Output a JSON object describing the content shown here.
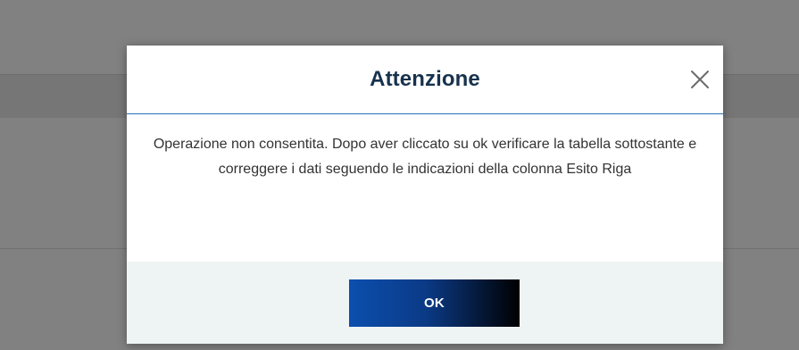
{
  "dialog": {
    "title": "Attenzione",
    "message": "Operazione non consentita. Dopo aver cliccato su ok verificare la tabella sottostante e correggere i dati seguendo le indicazioni della colonna Esito Riga",
    "ok_label": "OK",
    "close_icon": "close-icon"
  },
  "colors": {
    "title": "#17324d",
    "header_rule": "#1f73b7",
    "footer_bg": "#eef3f4",
    "button_gradient_start": "#0b4fae",
    "button_gradient_end": "#000000"
  }
}
